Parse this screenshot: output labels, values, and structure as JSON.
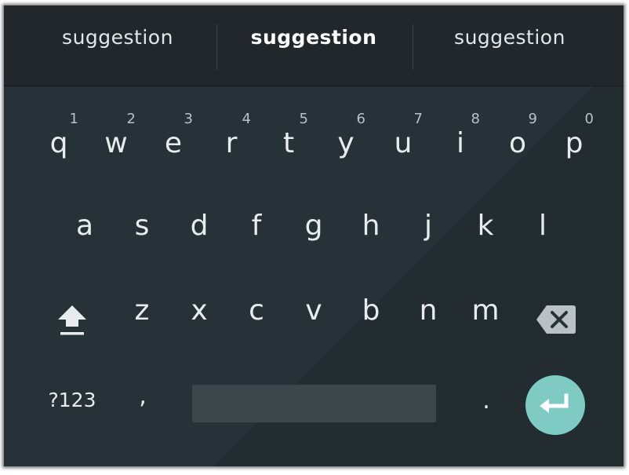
{
  "suggestions": [
    "suggestion",
    "suggestion",
    "suggestion"
  ],
  "row1": [
    {
      "letter": "q",
      "hint": "1"
    },
    {
      "letter": "w",
      "hint": "2"
    },
    {
      "letter": "e",
      "hint": "3"
    },
    {
      "letter": "r",
      "hint": "4"
    },
    {
      "letter": "t",
      "hint": "5"
    },
    {
      "letter": "y",
      "hint": "6"
    },
    {
      "letter": "u",
      "hint": "7"
    },
    {
      "letter": "i",
      "hint": "8"
    },
    {
      "letter": "o",
      "hint": "9"
    },
    {
      "letter": "p",
      "hint": "0"
    }
  ],
  "row2": [
    "a",
    "s",
    "d",
    "f",
    "g",
    "h",
    "j",
    "k",
    "l"
  ],
  "row3": [
    "z",
    "x",
    "c",
    "v",
    "b",
    "n",
    "m"
  ],
  "bottom": {
    "symbols_label": "?123",
    "comma_label": ",",
    "period_label": "."
  },
  "colors": {
    "background": "#263238",
    "suggestion_strip": "#21272b",
    "key_text": "#e8ecee",
    "space_bar": "#3c464b",
    "enter_accent": "#7fcbc4"
  },
  "icons": {
    "shift": "shift-icon",
    "delete": "backspace-icon",
    "enter": "enter-icon"
  }
}
